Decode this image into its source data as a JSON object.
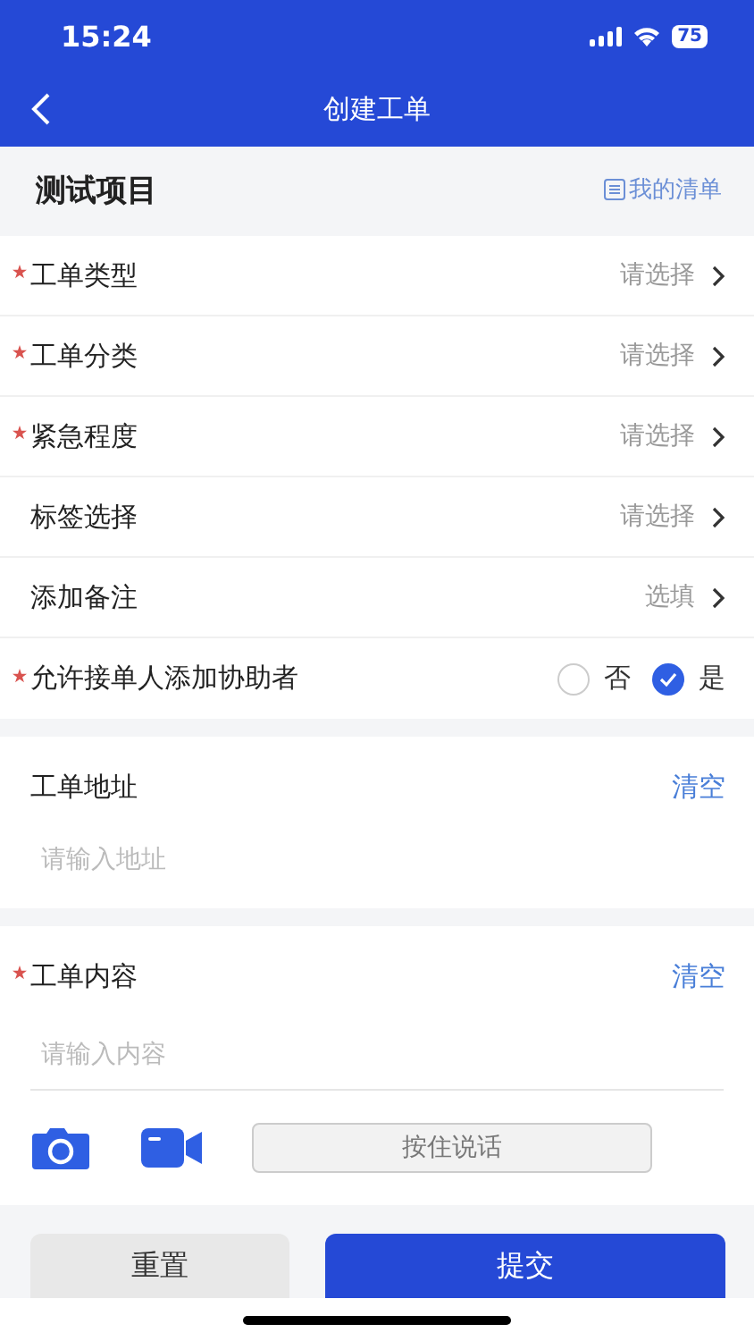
{
  "status_bar": {
    "time": "15:24",
    "battery": "75"
  },
  "nav": {
    "title": "创建工单"
  },
  "project": {
    "title": "测试项目",
    "link": "我的清单"
  },
  "rows": [
    {
      "kind": "select",
      "label": "工单类型",
      "required": true,
      "value": "请选择"
    },
    {
      "kind": "select",
      "label": "工单分类",
      "required": true,
      "value": "请选择"
    },
    {
      "kind": "select",
      "label": "紧急程度",
      "required": true,
      "value": "请选择"
    },
    {
      "kind": "select",
      "label": "标签选择",
      "required": false,
      "value": "请选择"
    },
    {
      "kind": "select",
      "label": "添加备注",
      "required": false,
      "value": "选填"
    },
    {
      "kind": "radio",
      "label": "允许接单人添加协助者",
      "required": true,
      "options": [
        {
          "label": "否",
          "selected": false
        },
        {
          "label": "是",
          "selected": true
        }
      ]
    }
  ],
  "address": {
    "label": "工单地址",
    "required": false,
    "action": "清空",
    "placeholder": "请输入地址"
  },
  "content": {
    "label": "工单内容",
    "required": true,
    "action": "清空",
    "placeholder": "请输入内容",
    "voice_button": "按住说话"
  },
  "buttons": [
    {
      "kind": "secondary",
      "label": "重置"
    },
    {
      "kind": "primary",
      "label": "提交"
    }
  ]
}
